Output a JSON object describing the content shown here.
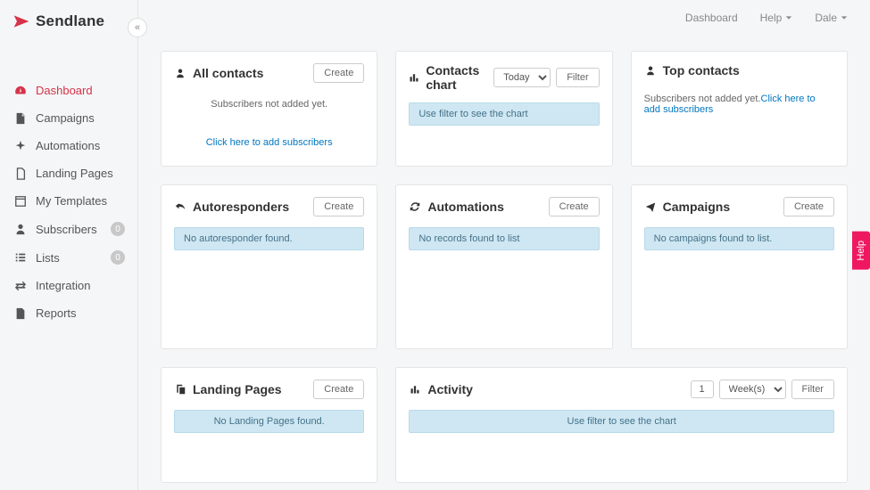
{
  "brand": {
    "name": "Sendlane"
  },
  "topbar": {
    "items": [
      {
        "label": "Dashboard",
        "caret": false
      },
      {
        "label": "Help",
        "caret": true
      },
      {
        "label": "Dale",
        "caret": true
      }
    ]
  },
  "sidebar": {
    "items": [
      {
        "label": "Dashboard",
        "icon": "gauge-icon",
        "active": true
      },
      {
        "label": "Campaigns",
        "icon": "file-icon"
      },
      {
        "label": "Automations",
        "icon": "sparkle-icon"
      },
      {
        "label": "Landing Pages",
        "icon": "page-icon"
      },
      {
        "label": "My Templates",
        "icon": "template-icon"
      },
      {
        "label": "Subscribers",
        "icon": "person-icon",
        "badge": "0"
      },
      {
        "label": "Lists",
        "icon": "list-icon",
        "badge": "0"
      },
      {
        "label": "Integration",
        "icon": "swap-icon"
      },
      {
        "label": "Reports",
        "icon": "report-icon"
      }
    ]
  },
  "cards": {
    "all_contacts": {
      "title": "All contacts",
      "create_label": "Create",
      "empty": "Subscribers not added yet.",
      "link": "Click here to add subscribers"
    },
    "contacts_chart": {
      "title": "Contacts chart",
      "date_filter": "Today",
      "filter_label": "Filter",
      "info": "Use filter to see the chart"
    },
    "top_contacts": {
      "title": "Top contacts",
      "empty": "Subscribers not added yet.",
      "link": "Click here to add subscribers"
    },
    "autoresponders": {
      "title": "Autoresponders",
      "create_label": "Create",
      "info": "No autoresponder found."
    },
    "automations": {
      "title": "Automations",
      "create_label": "Create",
      "info": "No records found to list"
    },
    "campaigns": {
      "title": "Campaigns",
      "create_label": "Create",
      "info": "No campaigns found to list."
    },
    "landing_pages": {
      "title": "Landing Pages",
      "create_label": "Create",
      "info": "No Landing Pages found."
    },
    "activity": {
      "title": "Activity",
      "number": "1",
      "period": "Week(s)",
      "filter_label": "Filter",
      "info": "Use filter to see the chart"
    }
  },
  "help_tab": "Help"
}
